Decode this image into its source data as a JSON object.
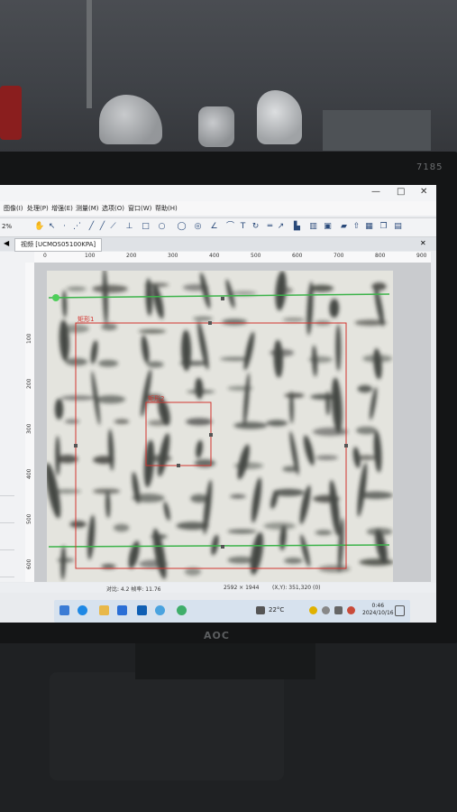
{
  "monitor": {
    "model": "7185",
    "brand": "AOC"
  },
  "window": {
    "menus": [
      "图像(I)",
      "处理(P)",
      "增强(E)",
      "测量(M)",
      "选项(O)",
      "窗口(W)",
      "帮助(H)"
    ],
    "tab_label": "视频 [UCMOS05100KPA]",
    "zoom": "2%",
    "controls": [
      "—",
      "□",
      "✕"
    ]
  },
  "ruler": {
    "top_ticks": [
      "0",
      "100",
      "200",
      "300",
      "400",
      "500",
      "600",
      "700",
      "800",
      "900"
    ],
    "left_ticks": [
      "100",
      "200",
      "300",
      "400",
      "500",
      "600"
    ]
  },
  "overlay_labels": {
    "rect1": "矩形1",
    "rect2": "矩形2"
  },
  "statusbar": {
    "left": "对比: 4.2  帧率: 11.76",
    "mid": "2592 × 1944",
    "right": "(X,Y): 351,320 (0)"
  },
  "taskbar": {
    "weather": "22°C",
    "time": "0:46",
    "date": "2024/10/16"
  },
  "colors": {
    "measure_red": "#d2332e",
    "measure_green": "#3cb34a",
    "taskbar": "#d7e2ee"
  }
}
